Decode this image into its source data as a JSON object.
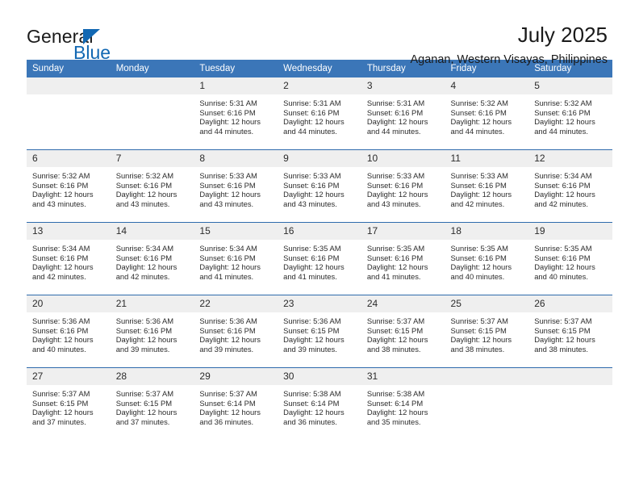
{
  "logo": {
    "text_top": "General",
    "text_bottom": "Blue",
    "triangle_color": "#1268b3",
    "text_top_color": "#1b1b1b",
    "text_bottom_color": "#1268b3"
  },
  "header": {
    "title": "July 2025",
    "subtitle": "Aganan, Western Visayas, Philippines"
  },
  "theme": {
    "header_blue": "#3b76b8",
    "row_divider": "#2f6bad",
    "daynum_bg": "#efefef",
    "text": "#2b2b2b",
    "page_bg": "#ffffff"
  },
  "calendar": {
    "weekday_headers": [
      "Sunday",
      "Monday",
      "Tuesday",
      "Wednesday",
      "Thursday",
      "Friday",
      "Saturday"
    ],
    "labels": {
      "sunrise_prefix": "Sunrise:",
      "sunset_prefix": "Sunset:",
      "daylight_prefix": "Daylight:"
    },
    "weeks": [
      [
        {
          "day": "",
          "empty": true
        },
        {
          "day": "",
          "empty": true
        },
        {
          "day": "1",
          "sunrise": "Sunrise: 5:31 AM",
          "sunset": "Sunset: 6:16 PM",
          "daylight": "Daylight: 12 hours and 44 minutes."
        },
        {
          "day": "2",
          "sunrise": "Sunrise: 5:31 AM",
          "sunset": "Sunset: 6:16 PM",
          "daylight": "Daylight: 12 hours and 44 minutes."
        },
        {
          "day": "3",
          "sunrise": "Sunrise: 5:31 AM",
          "sunset": "Sunset: 6:16 PM",
          "daylight": "Daylight: 12 hours and 44 minutes."
        },
        {
          "day": "4",
          "sunrise": "Sunrise: 5:32 AM",
          "sunset": "Sunset: 6:16 PM",
          "daylight": "Daylight: 12 hours and 44 minutes."
        },
        {
          "day": "5",
          "sunrise": "Sunrise: 5:32 AM",
          "sunset": "Sunset: 6:16 PM",
          "daylight": "Daylight: 12 hours and 44 minutes."
        }
      ],
      [
        {
          "day": "6",
          "sunrise": "Sunrise: 5:32 AM",
          "sunset": "Sunset: 6:16 PM",
          "daylight": "Daylight: 12 hours and 43 minutes."
        },
        {
          "day": "7",
          "sunrise": "Sunrise: 5:32 AM",
          "sunset": "Sunset: 6:16 PM",
          "daylight": "Daylight: 12 hours and 43 minutes."
        },
        {
          "day": "8",
          "sunrise": "Sunrise: 5:33 AM",
          "sunset": "Sunset: 6:16 PM",
          "daylight": "Daylight: 12 hours and 43 minutes."
        },
        {
          "day": "9",
          "sunrise": "Sunrise: 5:33 AM",
          "sunset": "Sunset: 6:16 PM",
          "daylight": "Daylight: 12 hours and 43 minutes."
        },
        {
          "day": "10",
          "sunrise": "Sunrise: 5:33 AM",
          "sunset": "Sunset: 6:16 PM",
          "daylight": "Daylight: 12 hours and 43 minutes."
        },
        {
          "day": "11",
          "sunrise": "Sunrise: 5:33 AM",
          "sunset": "Sunset: 6:16 PM",
          "daylight": "Daylight: 12 hours and 42 minutes."
        },
        {
          "day": "12",
          "sunrise": "Sunrise: 5:34 AM",
          "sunset": "Sunset: 6:16 PM",
          "daylight": "Daylight: 12 hours and 42 minutes."
        }
      ],
      [
        {
          "day": "13",
          "sunrise": "Sunrise: 5:34 AM",
          "sunset": "Sunset: 6:16 PM",
          "daylight": "Daylight: 12 hours and 42 minutes."
        },
        {
          "day": "14",
          "sunrise": "Sunrise: 5:34 AM",
          "sunset": "Sunset: 6:16 PM",
          "daylight": "Daylight: 12 hours and 42 minutes."
        },
        {
          "day": "15",
          "sunrise": "Sunrise: 5:34 AM",
          "sunset": "Sunset: 6:16 PM",
          "daylight": "Daylight: 12 hours and 41 minutes."
        },
        {
          "day": "16",
          "sunrise": "Sunrise: 5:35 AM",
          "sunset": "Sunset: 6:16 PM",
          "daylight": "Daylight: 12 hours and 41 minutes."
        },
        {
          "day": "17",
          "sunrise": "Sunrise: 5:35 AM",
          "sunset": "Sunset: 6:16 PM",
          "daylight": "Daylight: 12 hours and 41 minutes."
        },
        {
          "day": "18",
          "sunrise": "Sunrise: 5:35 AM",
          "sunset": "Sunset: 6:16 PM",
          "daylight": "Daylight: 12 hours and 40 minutes."
        },
        {
          "day": "19",
          "sunrise": "Sunrise: 5:35 AM",
          "sunset": "Sunset: 6:16 PM",
          "daylight": "Daylight: 12 hours and 40 minutes."
        }
      ],
      [
        {
          "day": "20",
          "sunrise": "Sunrise: 5:36 AM",
          "sunset": "Sunset: 6:16 PM",
          "daylight": "Daylight: 12 hours and 40 minutes."
        },
        {
          "day": "21",
          "sunrise": "Sunrise: 5:36 AM",
          "sunset": "Sunset: 6:16 PM",
          "daylight": "Daylight: 12 hours and 39 minutes."
        },
        {
          "day": "22",
          "sunrise": "Sunrise: 5:36 AM",
          "sunset": "Sunset: 6:16 PM",
          "daylight": "Daylight: 12 hours and 39 minutes."
        },
        {
          "day": "23",
          "sunrise": "Sunrise: 5:36 AM",
          "sunset": "Sunset: 6:15 PM",
          "daylight": "Daylight: 12 hours and 39 minutes."
        },
        {
          "day": "24",
          "sunrise": "Sunrise: 5:37 AM",
          "sunset": "Sunset: 6:15 PM",
          "daylight": "Daylight: 12 hours and 38 minutes."
        },
        {
          "day": "25",
          "sunrise": "Sunrise: 5:37 AM",
          "sunset": "Sunset: 6:15 PM",
          "daylight": "Daylight: 12 hours and 38 minutes."
        },
        {
          "day": "26",
          "sunrise": "Sunrise: 5:37 AM",
          "sunset": "Sunset: 6:15 PM",
          "daylight": "Daylight: 12 hours and 38 minutes."
        }
      ],
      [
        {
          "day": "27",
          "sunrise": "Sunrise: 5:37 AM",
          "sunset": "Sunset: 6:15 PM",
          "daylight": "Daylight: 12 hours and 37 minutes."
        },
        {
          "day": "28",
          "sunrise": "Sunrise: 5:37 AM",
          "sunset": "Sunset: 6:15 PM",
          "daylight": "Daylight: 12 hours and 37 minutes."
        },
        {
          "day": "29",
          "sunrise": "Sunrise: 5:37 AM",
          "sunset": "Sunset: 6:14 PM",
          "daylight": "Daylight: 12 hours and 36 minutes."
        },
        {
          "day": "30",
          "sunrise": "Sunrise: 5:38 AM",
          "sunset": "Sunset: 6:14 PM",
          "daylight": "Daylight: 12 hours and 36 minutes."
        },
        {
          "day": "31",
          "sunrise": "Sunrise: 5:38 AM",
          "sunset": "Sunset: 6:14 PM",
          "daylight": "Daylight: 12 hours and 35 minutes."
        },
        {
          "day": "",
          "empty": true
        },
        {
          "day": "",
          "empty": true
        }
      ]
    ]
  }
}
